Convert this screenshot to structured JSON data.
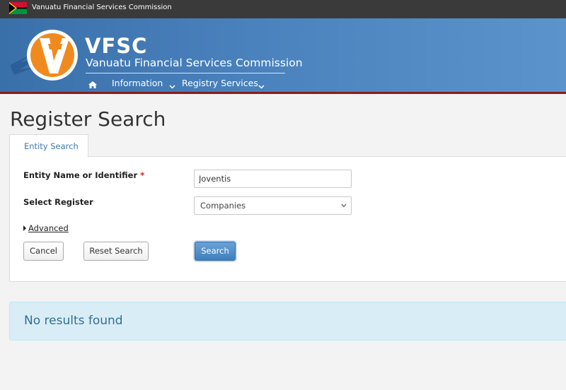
{
  "topbar": {
    "title": "Vanuatu Financial Services Commission"
  },
  "header": {
    "brand": "VFSC",
    "brand_subtitle": "Vanuatu Financial Services Commission",
    "nav": [
      {
        "label": "Information"
      },
      {
        "label": "Registry Services"
      }
    ]
  },
  "page": {
    "title": "Register Search"
  },
  "tabs": [
    {
      "label": "Entity Search",
      "active": true
    }
  ],
  "form": {
    "entity_label": "Entity Name or Identifier",
    "required_mark": "*",
    "entity_value": "Joventis",
    "register_label": "Select Register",
    "register_selected": "Companies",
    "advanced_label": "Advanced"
  },
  "buttons": {
    "cancel": "Cancel",
    "reset": "Reset Search",
    "search": "Search"
  },
  "result": {
    "message": "No results found"
  },
  "colors": {
    "header_blue": "#4a82bd",
    "accent_red": "#8b1a1a",
    "primary": "#3f7fbd",
    "alert_bg": "#d9edf7",
    "alert_text": "#31708f"
  }
}
